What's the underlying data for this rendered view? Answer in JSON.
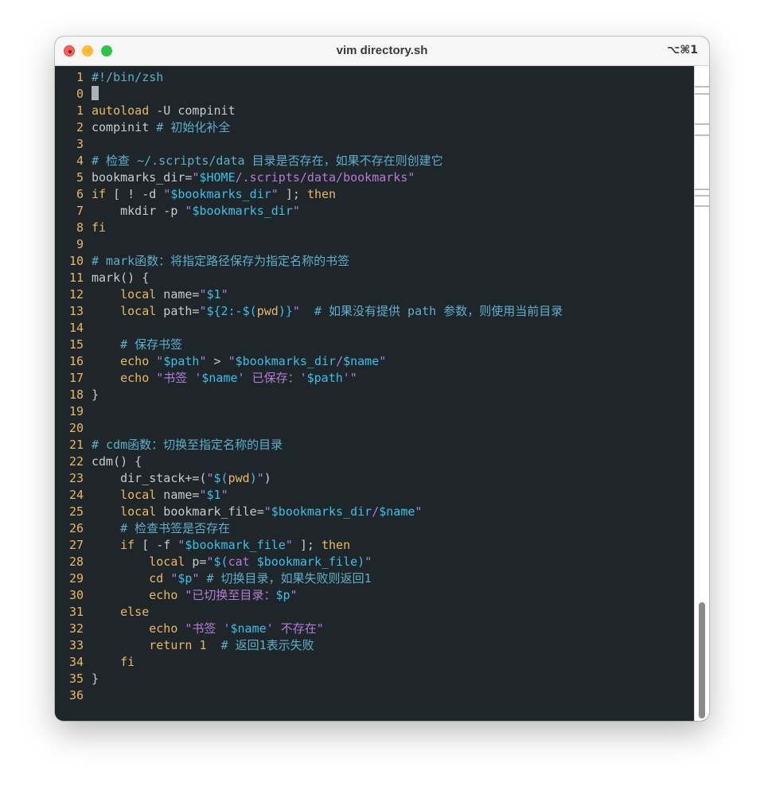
{
  "window": {
    "title": "vim directory.sh",
    "shortcut": "⌥⌘1"
  },
  "colors": {
    "background": "#1f2629",
    "comment": "#5cb0cc",
    "string": "#b47ad8",
    "variable": "#39c0e8",
    "keyword": "#e9b863",
    "plain": "#c5ccd0",
    "line_number": "#e9b863"
  },
  "editor": {
    "lines": [
      {
        "n": "1",
        "segs": [
          [
            "cm",
            "#!/bin/zsh"
          ]
        ]
      },
      {
        "n": "0",
        "segs": [],
        "cursor": true
      },
      {
        "n": "1",
        "segs": [
          [
            "kw",
            "autoload"
          ],
          [
            "pl",
            " -U compinit"
          ]
        ]
      },
      {
        "n": "2",
        "segs": [
          [
            "pl",
            "compinit "
          ],
          [
            "cm",
            "# 初始化补全"
          ]
        ]
      },
      {
        "n": "3",
        "segs": []
      },
      {
        "n": "4",
        "segs": [
          [
            "cm",
            "# 检查 ~/.scripts/data 目录是否存在，如果不存在则创建它"
          ]
        ]
      },
      {
        "n": "5",
        "segs": [
          [
            "pl",
            "bookmarks_dir="
          ],
          [
            "str",
            "\""
          ],
          [
            "var",
            "$HOME"
          ],
          [
            "str",
            "/.scripts/data/bookmarks\""
          ]
        ]
      },
      {
        "n": "6",
        "segs": [
          [
            "kw",
            "if"
          ],
          [
            "pl",
            " [ ! -d "
          ],
          [
            "str",
            "\""
          ],
          [
            "var",
            "$bookmarks_dir"
          ],
          [
            "str",
            "\""
          ],
          [
            "pl",
            " ]; "
          ],
          [
            "kw",
            "then"
          ]
        ]
      },
      {
        "n": "7",
        "segs": [
          [
            "pl",
            "    mkdir -p "
          ],
          [
            "str",
            "\""
          ],
          [
            "var",
            "$bookmarks_dir"
          ],
          [
            "str",
            "\""
          ]
        ]
      },
      {
        "n": "8",
        "segs": [
          [
            "kw",
            "fi"
          ]
        ]
      },
      {
        "n": "9",
        "segs": []
      },
      {
        "n": "10",
        "segs": [
          [
            "cm",
            "# mark函数：将指定路径保存为指定名称的书签"
          ]
        ]
      },
      {
        "n": "11",
        "segs": [
          [
            "pl",
            "mark() {"
          ]
        ]
      },
      {
        "n": "12",
        "segs": [
          [
            "pl",
            "    "
          ],
          [
            "kw",
            "local"
          ],
          [
            "pl",
            " name="
          ],
          [
            "str",
            "\""
          ],
          [
            "var",
            "$1"
          ],
          [
            "str",
            "\""
          ]
        ]
      },
      {
        "n": "13",
        "segs": [
          [
            "pl",
            "    "
          ],
          [
            "kw",
            "local"
          ],
          [
            "pl",
            " path="
          ],
          [
            "str",
            "\""
          ],
          [
            "var",
            "${2:-$("
          ],
          [
            "kw",
            "pwd"
          ],
          [
            "var",
            ")}"
          ],
          [
            "str",
            "\""
          ],
          [
            "pl",
            "  "
          ],
          [
            "cm",
            "# 如果没有提供 path 参数，则使用当前目录"
          ]
        ]
      },
      {
        "n": "14",
        "segs": []
      },
      {
        "n": "15",
        "segs": [
          [
            "pl",
            "    "
          ],
          [
            "cm",
            "# 保存书签"
          ]
        ]
      },
      {
        "n": "16",
        "segs": [
          [
            "pl",
            "    "
          ],
          [
            "kw",
            "echo"
          ],
          [
            "pl",
            " "
          ],
          [
            "str",
            "\""
          ],
          [
            "var",
            "$path"
          ],
          [
            "str",
            "\""
          ],
          [
            "pl",
            " > "
          ],
          [
            "str",
            "\""
          ],
          [
            "var",
            "$bookmarks_dir"
          ],
          [
            "str",
            "/"
          ],
          [
            "var",
            "$name"
          ],
          [
            "str",
            "\""
          ]
        ]
      },
      {
        "n": "17",
        "segs": [
          [
            "pl",
            "    "
          ],
          [
            "kw",
            "echo"
          ],
          [
            "pl",
            " "
          ],
          [
            "str",
            "\"书签 '"
          ],
          [
            "var",
            "$name"
          ],
          [
            "str",
            "' 已保存：'"
          ],
          [
            "var",
            "$path"
          ],
          [
            "str",
            "'\""
          ]
        ]
      },
      {
        "n": "18",
        "segs": [
          [
            "pl",
            "}"
          ]
        ]
      },
      {
        "n": "19",
        "segs": []
      },
      {
        "n": "20",
        "segs": []
      },
      {
        "n": "21",
        "segs": [
          [
            "cm",
            "# cdm函数：切换至指定名称的目录"
          ]
        ]
      },
      {
        "n": "22",
        "segs": [
          [
            "pl",
            "cdm() {"
          ]
        ]
      },
      {
        "n": "23",
        "segs": [
          [
            "pl",
            "    dir_stack+=("
          ],
          [
            "str",
            "\""
          ],
          [
            "var",
            "$("
          ],
          [
            "kw",
            "pwd"
          ],
          [
            "var",
            ")"
          ],
          [
            "str",
            "\""
          ],
          [
            "pl",
            ")"
          ]
        ]
      },
      {
        "n": "24",
        "segs": [
          [
            "pl",
            "    "
          ],
          [
            "kw",
            "local"
          ],
          [
            "pl",
            " name="
          ],
          [
            "str",
            "\""
          ],
          [
            "var",
            "$1"
          ],
          [
            "str",
            "\""
          ]
        ]
      },
      {
        "n": "25",
        "segs": [
          [
            "pl",
            "    "
          ],
          [
            "kw",
            "local"
          ],
          [
            "pl",
            " bookmark_file="
          ],
          [
            "str",
            "\""
          ],
          [
            "var",
            "$bookmarks_dir"
          ],
          [
            "str",
            "/"
          ],
          [
            "var",
            "$name"
          ],
          [
            "str",
            "\""
          ]
        ]
      },
      {
        "n": "26",
        "segs": [
          [
            "pl",
            "    "
          ],
          [
            "cm",
            "# 检查书签是否存在"
          ]
        ]
      },
      {
        "n": "27",
        "segs": [
          [
            "pl",
            "    "
          ],
          [
            "kw",
            "if"
          ],
          [
            "pl",
            " [ -f "
          ],
          [
            "str",
            "\""
          ],
          [
            "var",
            "$bookmark_file"
          ],
          [
            "str",
            "\""
          ],
          [
            "pl",
            " ]; "
          ],
          [
            "kw",
            "then"
          ]
        ]
      },
      {
        "n": "28",
        "segs": [
          [
            "pl",
            "        "
          ],
          [
            "kw",
            "local"
          ],
          [
            "pl",
            " p="
          ],
          [
            "str",
            "\""
          ],
          [
            "var",
            "$("
          ],
          [
            "str",
            "cat "
          ],
          [
            "var",
            "$bookmark_file"
          ],
          [
            "var",
            ")"
          ],
          [
            "str",
            "\""
          ]
        ]
      },
      {
        "n": "29",
        "segs": [
          [
            "pl",
            "        "
          ],
          [
            "kw",
            "cd"
          ],
          [
            "pl",
            " "
          ],
          [
            "str",
            "\""
          ],
          [
            "var",
            "$p"
          ],
          [
            "str",
            "\""
          ],
          [
            "pl",
            " "
          ],
          [
            "cm",
            "# 切换目录，如果失败则返回1"
          ]
        ]
      },
      {
        "n": "30",
        "segs": [
          [
            "pl",
            "        "
          ],
          [
            "kw",
            "echo"
          ],
          [
            "pl",
            " "
          ],
          [
            "str",
            "\"已切换至目录："
          ],
          [
            "var",
            "$p"
          ],
          [
            "str",
            "\""
          ]
        ]
      },
      {
        "n": "31",
        "segs": [
          [
            "pl",
            "    "
          ],
          [
            "kw",
            "else"
          ]
        ]
      },
      {
        "n": "32",
        "segs": [
          [
            "pl",
            "        "
          ],
          [
            "kw",
            "echo"
          ],
          [
            "pl",
            " "
          ],
          [
            "str",
            "\"书签 '"
          ],
          [
            "var",
            "$name"
          ],
          [
            "str",
            "' 不存在\""
          ]
        ]
      },
      {
        "n": "33",
        "segs": [
          [
            "pl",
            "        "
          ],
          [
            "kw",
            "return"
          ],
          [
            "pl",
            " "
          ],
          [
            "kw",
            "1"
          ],
          [
            "pl",
            "  "
          ],
          [
            "cm",
            "# 返回1表示失败"
          ]
        ]
      },
      {
        "n": "34",
        "segs": [
          [
            "pl",
            "    "
          ],
          [
            "kw",
            "fi"
          ]
        ]
      },
      {
        "n": "35",
        "segs": [
          [
            "pl",
            "}"
          ]
        ]
      },
      {
        "n": "36",
        "segs": []
      }
    ]
  }
}
